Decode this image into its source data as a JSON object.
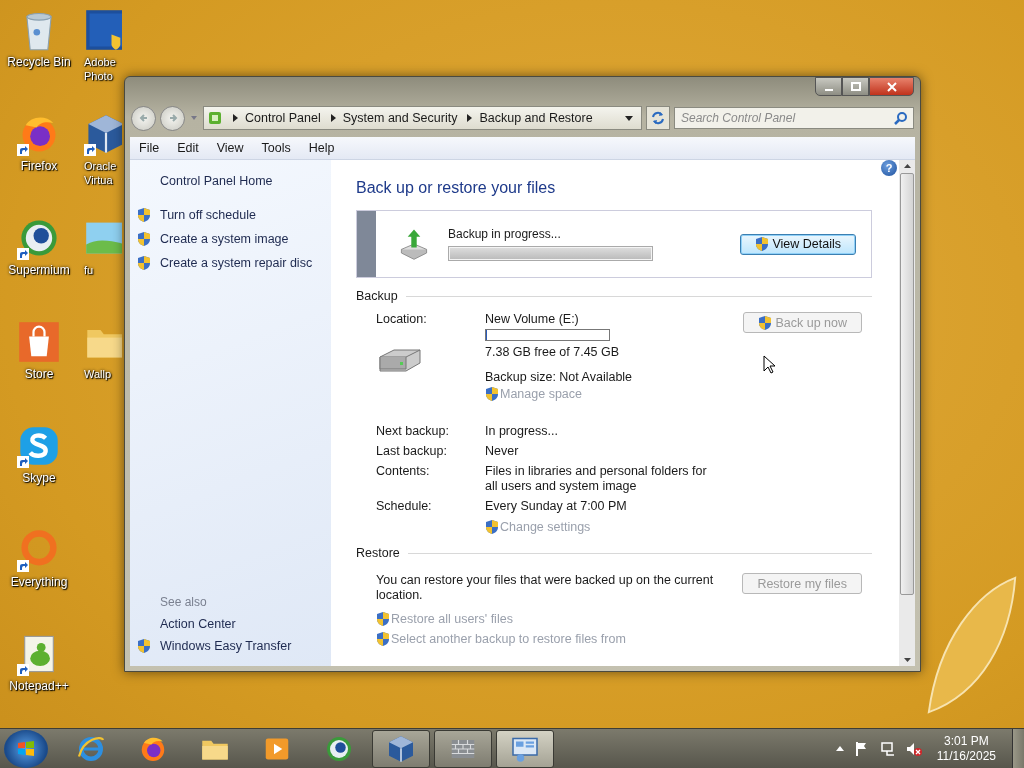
{
  "desktop": {
    "columns": [
      [
        {
          "label": "Recycle Bin",
          "kind": "bin",
          "shortcut": false
        },
        {
          "label": "Firefox",
          "kind": "firefox",
          "shortcut": true
        },
        {
          "label": "Supermium",
          "kind": "globe",
          "shortcut": true
        },
        {
          "label": "Store",
          "kind": "store",
          "shortcut": false
        },
        {
          "label": "Skype",
          "kind": "skype",
          "shortcut": true
        },
        {
          "label": "Everything",
          "kind": "ring",
          "shortcut": true
        },
        {
          "label": "Notepad++",
          "kind": "notepad",
          "shortcut": true
        }
      ],
      [
        {
          "label": "Adobe Photo",
          "kind": "ps",
          "shortcut": false
        },
        {
          "label": "Oracle Virtua",
          "kind": "cube",
          "shortcut": true
        },
        {
          "label": "fu",
          "kind": "picture",
          "shortcut": false
        },
        {
          "label": "Wallp",
          "kind": "folder",
          "shortcut": false
        }
      ]
    ]
  },
  "window": {
    "address": {
      "crumbs": [
        "Control Panel",
        "System and Security",
        "Backup and Restore"
      ]
    },
    "search": {
      "placeholder": "Search Control Panel"
    },
    "menu": [
      "File",
      "Edit",
      "View",
      "Tools",
      "Help"
    ],
    "help": "?",
    "sidebar": {
      "home": "Control Panel Home",
      "tasks": [
        {
          "label": "Turn off schedule",
          "shield": true
        },
        {
          "label": "Create a system image",
          "shield": true
        },
        {
          "label": "Create a system repair disc",
          "shield": true
        }
      ],
      "see_also": {
        "heading": "See also",
        "items": [
          {
            "label": "Action Center",
            "shield": false
          },
          {
            "label": "Windows Easy Transfer",
            "shield": true
          }
        ]
      }
    },
    "heading": "Back up or restore your files",
    "status": {
      "text": "Backup in progress...",
      "level": 1,
      "button": {
        "label": "View Details",
        "disabled": false
      }
    },
    "backup": {
      "title": "Backup",
      "location": {
        "label": "Location:",
        "volume": "New Volume (E:)",
        "level": 0.01,
        "free": "7.38 GB free of 7.45 GB",
        "size": "Backup size: Not Available",
        "link": {
          "label": "Manage space",
          "disabled": true
        }
      },
      "button": {
        "label": "Back up now",
        "disabled": true
      },
      "details": [
        {
          "label": "Next backup:",
          "value": "In progress..."
        },
        {
          "label": "Last backup:",
          "value": "Never"
        },
        {
          "label": "Contents:",
          "value": "Files in libraries and personal folders for all users and system image"
        },
        {
          "label": "Schedule:",
          "value": "Every Sunday at 7:00 PM"
        }
      ],
      "link": {
        "label": "Change settings",
        "disabled": true
      }
    },
    "restore": {
      "title": "Restore",
      "text": "You can restore your files that were backed up on the current location.",
      "button": {
        "label": "Restore my files",
        "disabled": true
      },
      "links": [
        {
          "label": "Restore all users' files",
          "disabled": true
        },
        {
          "label": "Select another backup to restore files from",
          "disabled": true
        }
      ]
    }
  },
  "taskbar": {
    "items": [
      {
        "kind": "ie",
        "running": false,
        "selected": false
      },
      {
        "kind": "firefox",
        "running": false,
        "selected": false
      },
      {
        "kind": "folder",
        "running": false,
        "selected": false
      },
      {
        "kind": "media",
        "running": false,
        "selected": false
      },
      {
        "kind": "globe",
        "running": false,
        "selected": false
      },
      {
        "kind": "cube",
        "running": true,
        "selected": false
      },
      {
        "kind": "wall",
        "running": true,
        "selected": false
      },
      {
        "kind": "panel",
        "running": true,
        "selected": true
      }
    ],
    "clock": {
      "time": "3:01 PM",
      "date": "11/16/2025"
    }
  }
}
